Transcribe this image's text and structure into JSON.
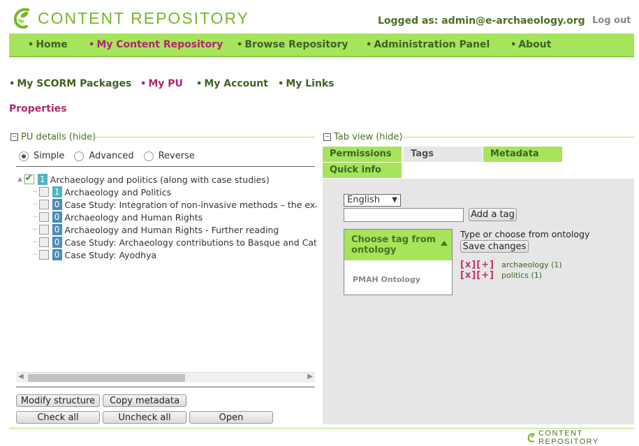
{
  "header": {
    "logo_text": "CONTENT REPOSITORY",
    "logged_as": "Logged as: admin@e-archaeology.org",
    "logout": "Log out"
  },
  "topnav": [
    {
      "label": "Home",
      "active": false
    },
    {
      "label": "My Content Repository",
      "active": true
    },
    {
      "label": "Browse Repository",
      "active": false
    },
    {
      "label": "Administration Panel",
      "active": false
    },
    {
      "label": "About",
      "active": false
    }
  ],
  "subnav": [
    {
      "label": "My SCORM Packages",
      "active": false
    },
    {
      "label": "My PU",
      "active": true
    },
    {
      "label": "My Account",
      "active": false
    },
    {
      "label": "My Links",
      "active": false
    }
  ],
  "page_title": "Properties",
  "pu_details": {
    "title": "PU details (hide)",
    "toggle": "−",
    "radios": [
      {
        "label": "Simple",
        "selected": true
      },
      {
        "label": "Advanced",
        "selected": false
      },
      {
        "label": "Reverse",
        "selected": false
      }
    ],
    "tree": [
      {
        "badge": "1",
        "label": "Archaeology and politics (along with case studies)",
        "checked": true,
        "root": true
      },
      {
        "badge": "1",
        "label": "Archaeology and Politics",
        "checked": false
      },
      {
        "badge": "0",
        "label": "Case Study: Integration of non-invasive methods – the exa",
        "checked": false
      },
      {
        "badge": "0",
        "label": "Archaeology and Human Rights",
        "checked": false
      },
      {
        "badge": "0",
        "label": "Archaeology and Human Rights - Further reading",
        "checked": false
      },
      {
        "badge": "0",
        "label": "Case Study: Archaeology contributions to Basque and Cata",
        "checked": false
      },
      {
        "badge": "0",
        "label": "Case Study: Ayodhya",
        "checked": false
      }
    ],
    "buttons": {
      "modify": "Modify structure",
      "copy": "Copy metadata",
      "check_all": "Check all",
      "uncheck_all": "Uncheck all",
      "open": "Open"
    }
  },
  "tab_view": {
    "title": "Tab view (hide)",
    "toggle": "−",
    "tabs": {
      "permissions": "Permissions",
      "tags": "Tags",
      "metadata": "Metadata",
      "quick_info": "Quick info"
    },
    "language": "English",
    "tag_input_value": "",
    "add_tag": "Add a tag",
    "chooser_title": "Choose tag from ontology",
    "ontology": "PMAH Ontology",
    "hint": "Type or choose from ontology",
    "save": "Save changes",
    "tag_controls": "[x][+]",
    "tags": [
      {
        "label": "archaeology (1)"
      },
      {
        "label": "politics (1)"
      }
    ]
  },
  "footer": {
    "logo_text": "CONTENT REPOSITORY"
  },
  "colors": {
    "nav_green": "#a6e45c",
    "active_magenta": "#b0266e",
    "dark_green": "#3b6420"
  }
}
